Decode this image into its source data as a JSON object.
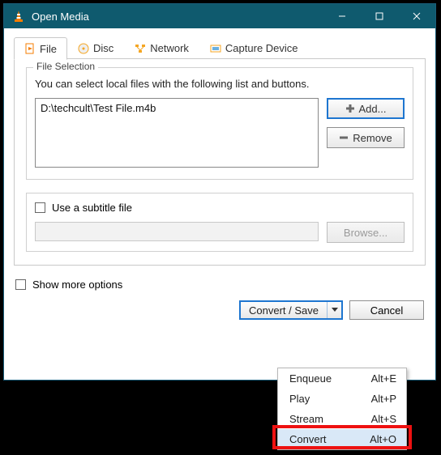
{
  "window": {
    "title": "Open Media"
  },
  "tabs": {
    "file": "File",
    "disc": "Disc",
    "network": "Network",
    "capture": "Capture Device"
  },
  "fileSelection": {
    "legend": "File Selection",
    "hint": "You can select local files with the following list and buttons.",
    "items": [
      "D:\\techcult\\Test File.m4b"
    ],
    "add": "Add...",
    "remove": "Remove"
  },
  "subtitle": {
    "checkbox": "Use a subtitle file",
    "browse": "Browse..."
  },
  "footer": {
    "showMore": "Show more options",
    "convertSave": "Convert / Save",
    "cancel": "Cancel"
  },
  "menu": {
    "items": [
      {
        "label": "Enqueue",
        "accel": "Alt+E"
      },
      {
        "label": "Play",
        "accel": "Alt+P"
      },
      {
        "label": "Stream",
        "accel": "Alt+S"
      },
      {
        "label": "Convert",
        "accel": "Alt+O",
        "hover": true
      }
    ]
  }
}
